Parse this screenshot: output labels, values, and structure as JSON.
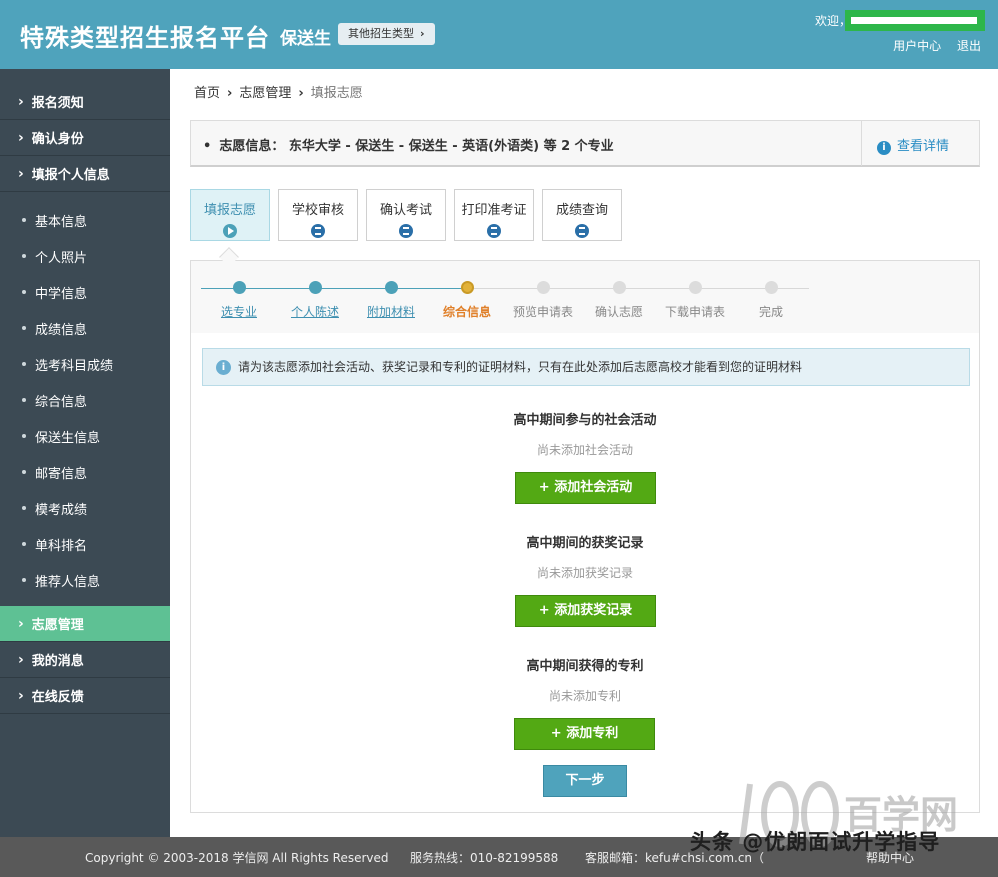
{
  "header": {
    "site_title": "特殊类型招生报名平台",
    "sub_type": "保送生",
    "other_types_label": "其他招生类型",
    "welcome": "欢迎，",
    "user_center": "用户中心",
    "logout": "退出"
  },
  "sidebar": {
    "top_items": [
      "报名须知",
      "确认身份",
      "填报个人信息"
    ],
    "sub_items": [
      "基本信息",
      "个人照片",
      "中学信息",
      "成绩信息",
      "选考科目成绩",
      "综合信息",
      "保送生信息",
      "邮寄信息",
      "模考成绩",
      "单科排名",
      "推荐人信息"
    ],
    "bottom_items": [
      "志愿管理",
      "我的消息",
      "在线反馈"
    ],
    "active_item": "志愿管理"
  },
  "breadcrumb": {
    "home": "首页",
    "level1": "志愿管理",
    "current": "填报志愿"
  },
  "info_bar": {
    "text": "志愿信息： 东华大学 - 保送生 - 保送生 - 英语(外语类) 等 2 个专业",
    "detail_link": "查看详情"
  },
  "tabs": [
    "填报志愿",
    "学校审核",
    "确认考试",
    "打印准考证",
    "成绩查询"
  ],
  "progress": {
    "steps": [
      "选专业",
      "个人陈述",
      "附加材料",
      "综合信息",
      "预览申请表",
      "确认志愿",
      "下载申请表",
      "完成"
    ],
    "current_index": 3
  },
  "notice": "请为该志愿添加社会活动、获奖记录和专利的证明材料，只有在此处添加后志愿高校才能看到您的证明材料",
  "sections": [
    {
      "title": "高中期间参与的社会活动",
      "empty_text": "尚未添加社会活动",
      "button": "+ 添加社会活动"
    },
    {
      "title": "高中期间的获奖记录",
      "empty_text": "尚未添加获奖记录",
      "button": "+ 添加获奖记录"
    },
    {
      "title": "高中期间获得的专利",
      "empty_text": "尚未添加专利",
      "button": "+ 添加专利"
    }
  ],
  "next_button": "下一步",
  "footer": {
    "copyright": "Copyright © 2003-2018 学信网 All Rights Reserved",
    "hotline": "服务热线：010-82199588",
    "email": "客服邮箱：kefu#chsi.com.cn（",
    "help": "帮助中心"
  },
  "watermark": {
    "text": "头条 @优朗面试升学指导",
    "logo_text": "百学网"
  },
  "colors": {
    "header_bg": "#4fa3bc",
    "sidebar_bg": "#3c4a54",
    "sidebar_active": "#5ec194",
    "add_button": "#53a914",
    "current_step": "#e0802a",
    "footer_bg": "#595959"
  }
}
